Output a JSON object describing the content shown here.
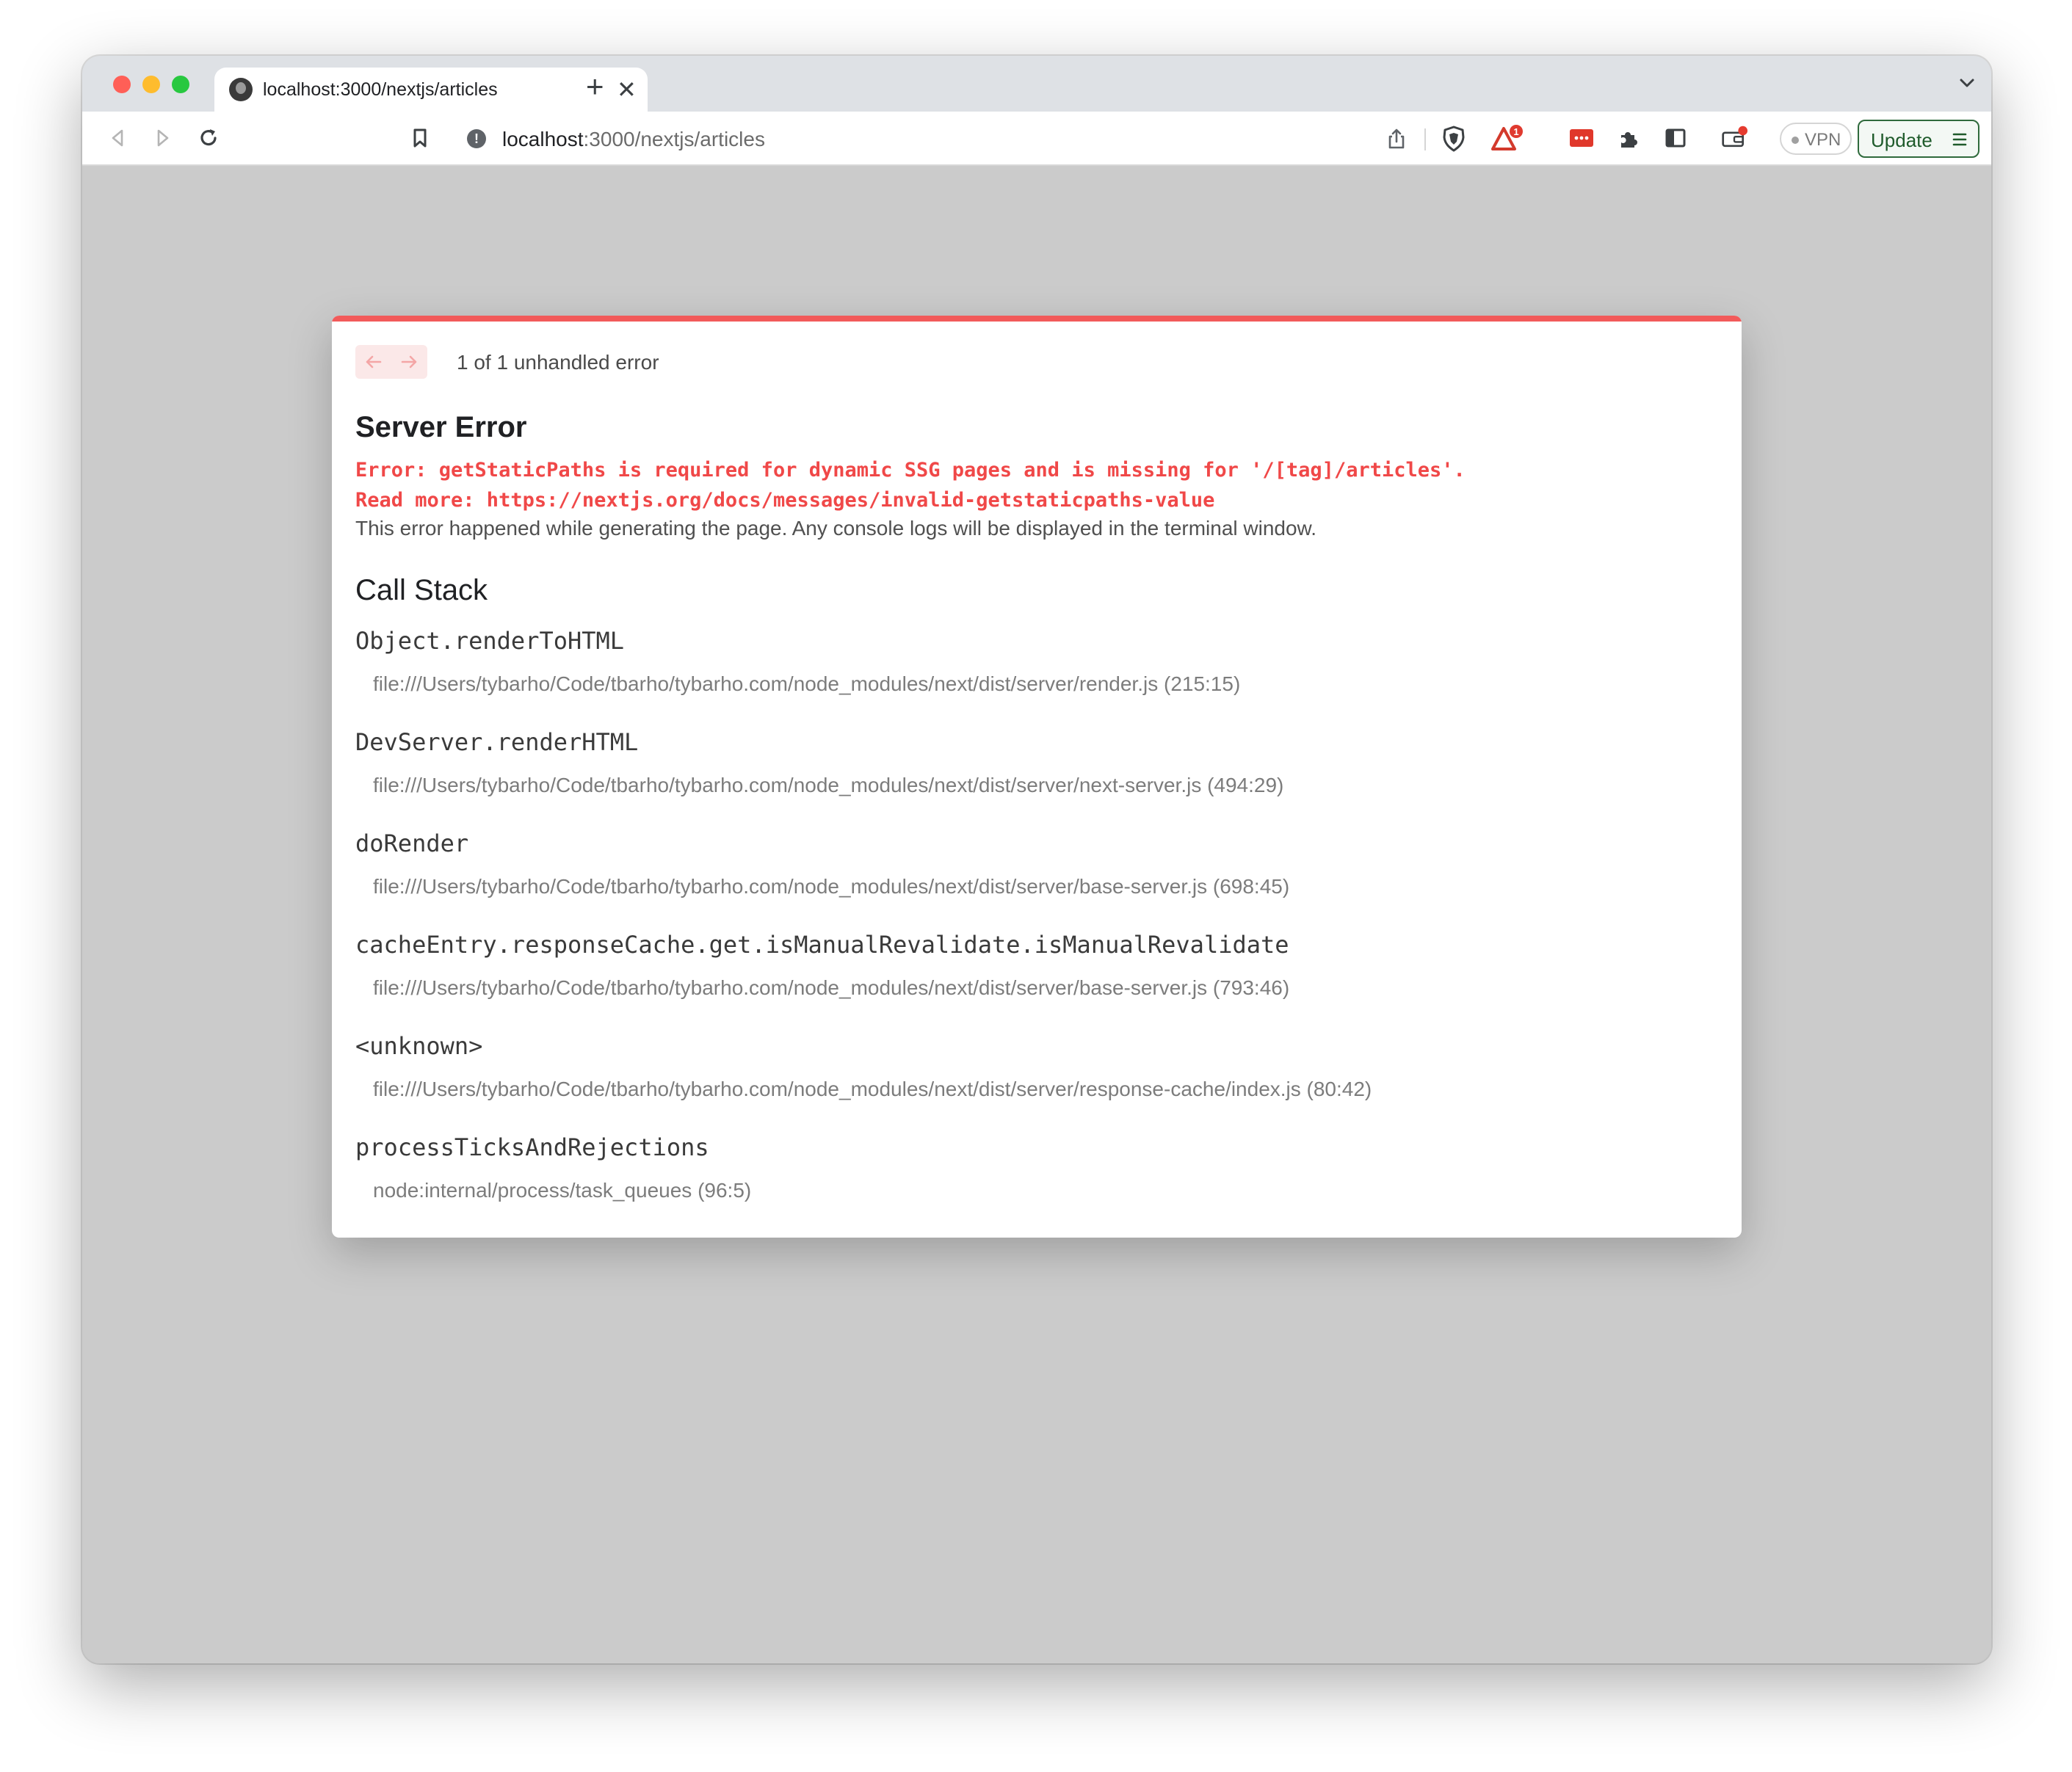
{
  "browser": {
    "tab": {
      "title": "localhost:3000/nextjs/articles",
      "close_glyph": "✕"
    },
    "new_tab_glyph": "+",
    "address": {
      "host": "localhost",
      "rest": ":3000/nextjs/articles"
    },
    "vpn_label": "VPN",
    "update_label": "Update",
    "rewards_badge": "1",
    "colors": {
      "tab_strip": "#dee1e5",
      "brave_orange": "#fb542b",
      "update_green": "#1f5b2b"
    }
  },
  "overlay": {
    "pager_text": "1 of 1 unhandled error",
    "title": "Server Error",
    "error_line1": "Error: getStaticPaths is required for dynamic SSG pages and is missing for '/[tag]/articles'.",
    "error_line2": "Read more: https://nextjs.org/docs/messages/invalid-getstaticpaths-value",
    "description": "This error happened while generating the page. Any console logs will be displayed in the terminal window.",
    "call_stack_title": "Call Stack",
    "frames": [
      {
        "name": "Object.renderToHTML",
        "file": "file:///Users/tybarho/Code/tbarho/tybarho.com/node_modules/next/dist/server/render.js (215:15)"
      },
      {
        "name": "DevServer.renderHTML",
        "file": "file:///Users/tybarho/Code/tbarho/tybarho.com/node_modules/next/dist/server/next-server.js (494:29)"
      },
      {
        "name": "doRender",
        "file": "file:///Users/tybarho/Code/tbarho/tybarho.com/node_modules/next/dist/server/base-server.js (698:45)"
      },
      {
        "name": "cacheEntry.responseCache.get.isManualRevalidate.isManualRevalidate",
        "file": "file:///Users/tybarho/Code/tbarho/tybarho.com/node_modules/next/dist/server/base-server.js (793:46)"
      },
      {
        "name": "<unknown>",
        "file": "file:///Users/tybarho/Code/tbarho/tybarho.com/node_modules/next/dist/server/response-cache/index.js (80:42)"
      },
      {
        "name": "processTicksAndRejections",
        "file": "node:internal/process/task_queues (96:5)"
      }
    ],
    "accent_color": "#f25a5a"
  }
}
